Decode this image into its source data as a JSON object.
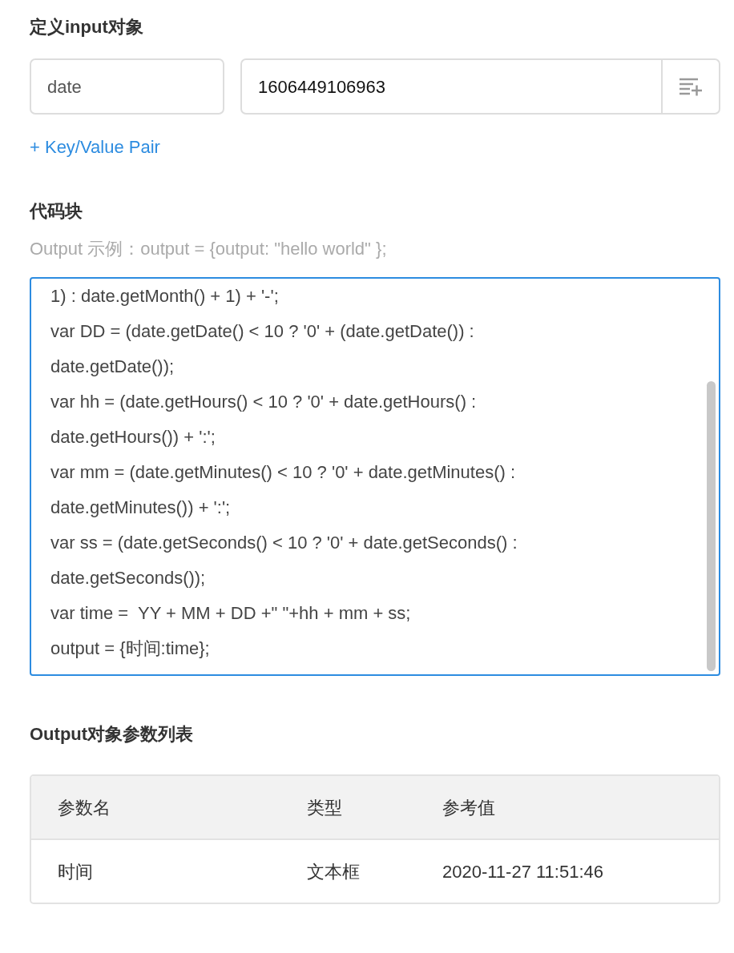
{
  "input_section": {
    "title": "定义input对象",
    "key": {
      "value": "date"
    },
    "value": {
      "value": "1606449106963"
    },
    "add_link": "+ Key/Value Pair"
  },
  "code_section": {
    "title": "代码块",
    "hint": "Output 示例：output = {output: \"hello world\" };",
    "lines": [
      "1) : date.getMonth() + 1) + '-';",
      "var DD = (date.getDate() < 10 ? '0' + (date.getDate()) :",
      "date.getDate());",
      "var hh = (date.getHours() < 10 ? '0' + date.getHours() :",
      "date.getHours()) + ':';",
      "var mm = (date.getMinutes() < 10 ? '0' + date.getMinutes() :",
      "date.getMinutes()) + ':';",
      "var ss = (date.getSeconds() < 10 ? '0' + date.getSeconds() :",
      "date.getSeconds());",
      "var time =  YY + MM + DD +\" \"+hh + mm + ss;",
      "output = {时间:time};"
    ]
  },
  "output_section": {
    "title": "Output对象参数列表",
    "columns": [
      "参数名",
      "类型",
      "参考值"
    ],
    "rows": [
      [
        "时间",
        "文本框",
        "2020-11-27 11:51:46"
      ]
    ]
  }
}
